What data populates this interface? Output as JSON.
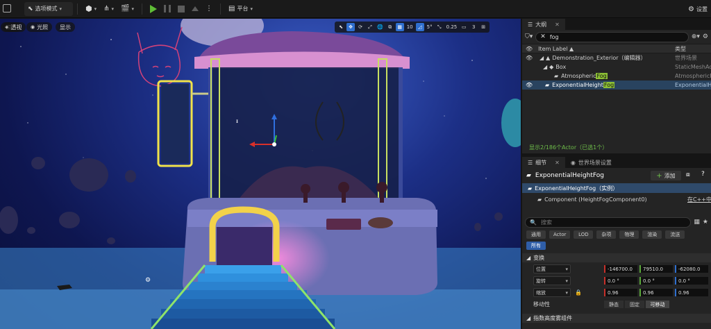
{
  "toolbar": {
    "mode_label": "选项模式",
    "platform_label": "平台",
    "settings_label": "设置"
  },
  "viewport": {
    "perspective_label": "透视",
    "lighting_label": "光照",
    "show_label": "显示",
    "grid_snap": "10",
    "rotation_snap": "5°",
    "scale_snap": "0.25",
    "camera_speed": "3"
  },
  "outliner": {
    "tab_title": "大纲",
    "search_value": "fog",
    "col_label": "Item Label ▲",
    "col_type": "类型",
    "rows": [
      {
        "label": "Demonstration_Exterior（编辑器）",
        "type": "世界场景"
      },
      {
        "label": "Box",
        "type": "StaticMeshActor"
      },
      {
        "label_pre": "Atmospheric",
        "label_hl": "Fog",
        "type": "AtmosphericFog"
      },
      {
        "label_pre": "ExponentialHeight",
        "label_hl": "Fog",
        "type": "ExponentialHeightFog"
      }
    ],
    "status": "显示2/186个Actor（已选1个）"
  },
  "details": {
    "tab_title": "细节",
    "tab_world": "世界场景设置",
    "object_name": "ExponentialHeightFog",
    "add_label": "添加",
    "instance_label": "ExponentialHeightFog（实例）",
    "component_label": "Component (HeightFogComponent0)",
    "cpp_label": "在C++中",
    "search_placeholder": "搜索",
    "filters": [
      "通用",
      "Actor",
      "LOD",
      "杂项",
      "物理",
      "渲染",
      "流送",
      "所有"
    ],
    "transform_header": "变换",
    "location_label": "位置",
    "rotation_label": "旋转",
    "scale_label": "缩放",
    "location": [
      "-146700.0",
      "79510.0",
      "-62080.0"
    ],
    "rotation": [
      "0.0 °",
      "0.0 °",
      "0.0 °"
    ],
    "scale": [
      "0.96",
      "0.96",
      "0.96"
    ],
    "mobility_label": "移动性",
    "mobility_options": [
      "静态",
      "固定",
      "可移动"
    ],
    "fog_section": "指数高度雾组件"
  }
}
